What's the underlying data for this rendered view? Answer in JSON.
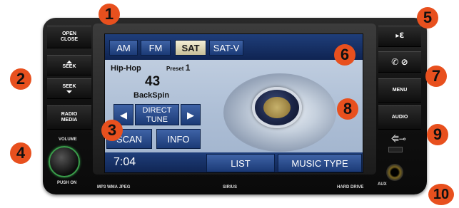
{
  "screen": {
    "tabs": [
      "AM",
      "FM",
      "SAT",
      "SAT-V"
    ],
    "selected_tab": "SAT",
    "genre": "Hip-Hop",
    "preset_label": "Preset",
    "preset_number": "1",
    "channel": "43",
    "station": "BackSpin",
    "direct_tune": [
      "DIRECT",
      "TUNE"
    ],
    "scan_label": "SCAN",
    "info_label": "INFO",
    "time": "7:04",
    "list_label": "LIST",
    "music_type_label": "MUSIC TYPE"
  },
  "left_buttons": {
    "open_close": [
      "OPEN",
      "CLOSE"
    ],
    "seek_up": "SEEK",
    "seek_down": "SEEK",
    "radio_media": [
      "RADIO",
      "MEDIA"
    ],
    "volume": "VOLUME",
    "push_on": "PUSH ON"
  },
  "right_buttons": {
    "menu": "MENU",
    "audio": "AUDIO",
    "aux": "AUX"
  },
  "footer": {
    "formats": "MP3 WMA JPEG",
    "sirius": "SIRIUS",
    "hdd": "HARD DRIVE"
  },
  "callouts": [
    "1",
    "2",
    "3",
    "4",
    "5",
    "6",
    "7",
    "8",
    "9",
    "10"
  ],
  "colors": {
    "callout": "#e8501e",
    "screen_bar": "#1f3e7a",
    "knob_ring": "#3a9d4a"
  }
}
